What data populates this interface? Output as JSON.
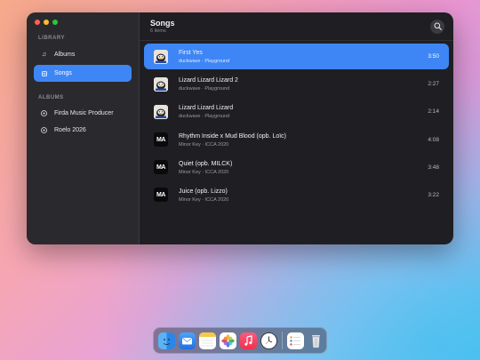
{
  "sidebar": {
    "library_heading": "LIBRARY",
    "library_items": [
      {
        "label": "Albums",
        "icon": "music-note-icon",
        "active": false
      },
      {
        "label": "Songs",
        "icon": "song-list-icon",
        "active": true
      }
    ],
    "albums_heading": "ALBUMS",
    "album_items": [
      {
        "label": "Firda Music Producer",
        "icon": "disc-icon"
      },
      {
        "label": "Roelo 2026",
        "icon": "disc-icon"
      }
    ]
  },
  "main": {
    "title": "Songs",
    "subtitle": "6 items",
    "search_icon": "search-icon"
  },
  "songs": [
    {
      "title": "First Yes",
      "subtitle": "duckwave · Playground",
      "duration": "3:50",
      "art": "duck",
      "active": true
    },
    {
      "title": "Lizard Lizard Lizard 2",
      "subtitle": "duckwave · Playground",
      "duration": "2:27",
      "art": "duck",
      "active": false
    },
    {
      "title": "Lizard Lizard Lizard",
      "subtitle": "duckwave · Playground",
      "duration": "2:14",
      "art": "duck",
      "active": false
    },
    {
      "title": "Rhythm Inside x Mud Blood (opb. Loïc)",
      "subtitle": "Minor Key · ICCA 2020",
      "duration": "4:08",
      "art": "MA",
      "active": false
    },
    {
      "title": "Quiet (opb. MILCK)",
      "subtitle": "Minor Key · ICCA 2020",
      "duration": "3:48",
      "art": "MA",
      "active": false
    },
    {
      "title": "Juice (opb. Lizzo)",
      "subtitle": "Minor Key · ICCA 2020",
      "duration": "3:22",
      "art": "MA",
      "active": false
    }
  ],
  "colors": {
    "accent": "#3e86f5",
    "window_bg": "#1f1f23",
    "sidebar_bg": "#2a2a2e"
  },
  "dock": [
    "finder-icon",
    "mail-icon",
    "notes-icon",
    "photos-icon",
    "music-icon",
    "clock-icon",
    "reminders-icon",
    "trash-icon"
  ]
}
